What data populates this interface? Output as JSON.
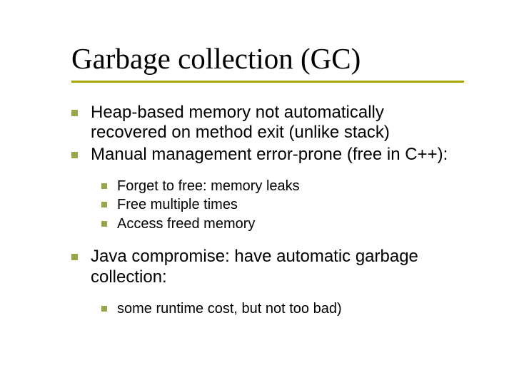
{
  "slide": {
    "title": "Garbage collection (GC)",
    "bullets": [
      {
        "text": "Heap-based memory not automatically recovered on method exit (unlike stack)"
      },
      {
        "text": "Manual management error-prone (free in C++):",
        "children": [
          {
            "text": "Forget to free: memory leaks"
          },
          {
            "text": "Free multiple times"
          },
          {
            "text": "Access freed memory"
          }
        ]
      },
      {
        "text": "Java compromise: have automatic garbage collection:",
        "children": [
          {
            "text": "some runtime cost, but not too bad)"
          }
        ]
      }
    ]
  }
}
